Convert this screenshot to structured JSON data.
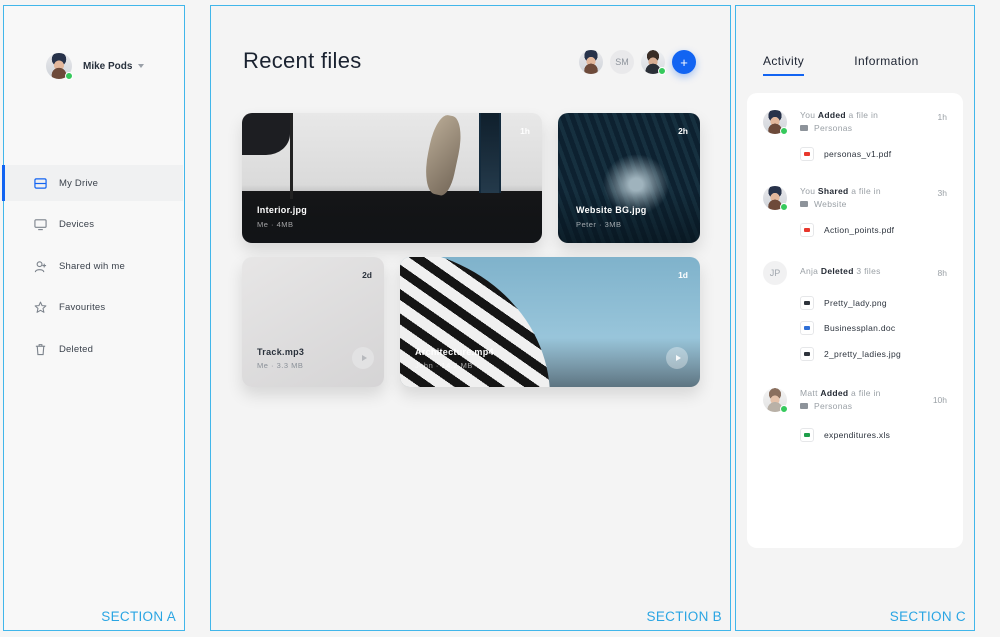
{
  "colors": {
    "accent": "#1264f2",
    "section_border": "#41b6ea",
    "online": "#36c95c"
  },
  "sections": {
    "a": "SECTION A",
    "b": "SECTION B",
    "c": "SECTION C"
  },
  "user": {
    "name": "Mike Pods"
  },
  "nav": [
    {
      "label": "My Drive",
      "icon": "drive-icon",
      "active": true
    },
    {
      "label": "Devices",
      "icon": "monitor-icon"
    },
    {
      "label": "Shared wih me",
      "icon": "add-user-icon"
    },
    {
      "label": "Favourites",
      "icon": "star-icon"
    },
    {
      "label": "Deleted",
      "icon": "trash-icon"
    }
  ],
  "main": {
    "title": "Recent files",
    "collaborators": {
      "initials": "SM",
      "add_label": "+"
    },
    "files": [
      {
        "name": "Interior.jpg",
        "meta": "Me  ·  4MB",
        "time": "1h"
      },
      {
        "name": "Website BG.jpg",
        "meta": "Peter  ·  3MB",
        "time": "2h"
      },
      {
        "name": "Track.mp3",
        "meta": "Me  ·  3.3 MB",
        "time": "2d"
      },
      {
        "name": "Architecture.mp4",
        "meta": "John  ·  14.2 MB",
        "time": "1d"
      }
    ]
  },
  "activity_panel": {
    "tabs": {
      "activity": "Activity",
      "information": "Information"
    },
    "items": [
      {
        "actor": "You",
        "action": "Added",
        "rest": "a file in",
        "folder": "Personas",
        "time": "1h",
        "files": [
          {
            "name": "personas_v1.pdf",
            "type": "pdf",
            "color": "#e8372c"
          }
        ]
      },
      {
        "actor": "You",
        "action": "Shared",
        "rest": "a file in",
        "folder": "Website",
        "time": "3h",
        "files": [
          {
            "name": "Action_points.pdf",
            "type": "pdf",
            "color": "#e8372c"
          }
        ]
      },
      {
        "actor": "Anja",
        "initials": "JP",
        "action": "Deleted",
        "rest": "3 files",
        "time": "8h",
        "files": [
          {
            "name": "Pretty_lady.png",
            "type": "image",
            "color": "#2d333b"
          },
          {
            "name": "Businessplan.doc",
            "type": "doc",
            "color": "#2f6fd6"
          },
          {
            "name": "2_pretty_ladies.jpg",
            "type": "image",
            "color": "#2d333b"
          }
        ]
      },
      {
        "actor": "Matt",
        "action": "Added",
        "rest": "a file in",
        "folder": "Personas",
        "time": "10h",
        "files": [
          {
            "name": "expenditures.xls",
            "type": "sheet",
            "color": "#1e9e4a"
          }
        ]
      }
    ]
  }
}
